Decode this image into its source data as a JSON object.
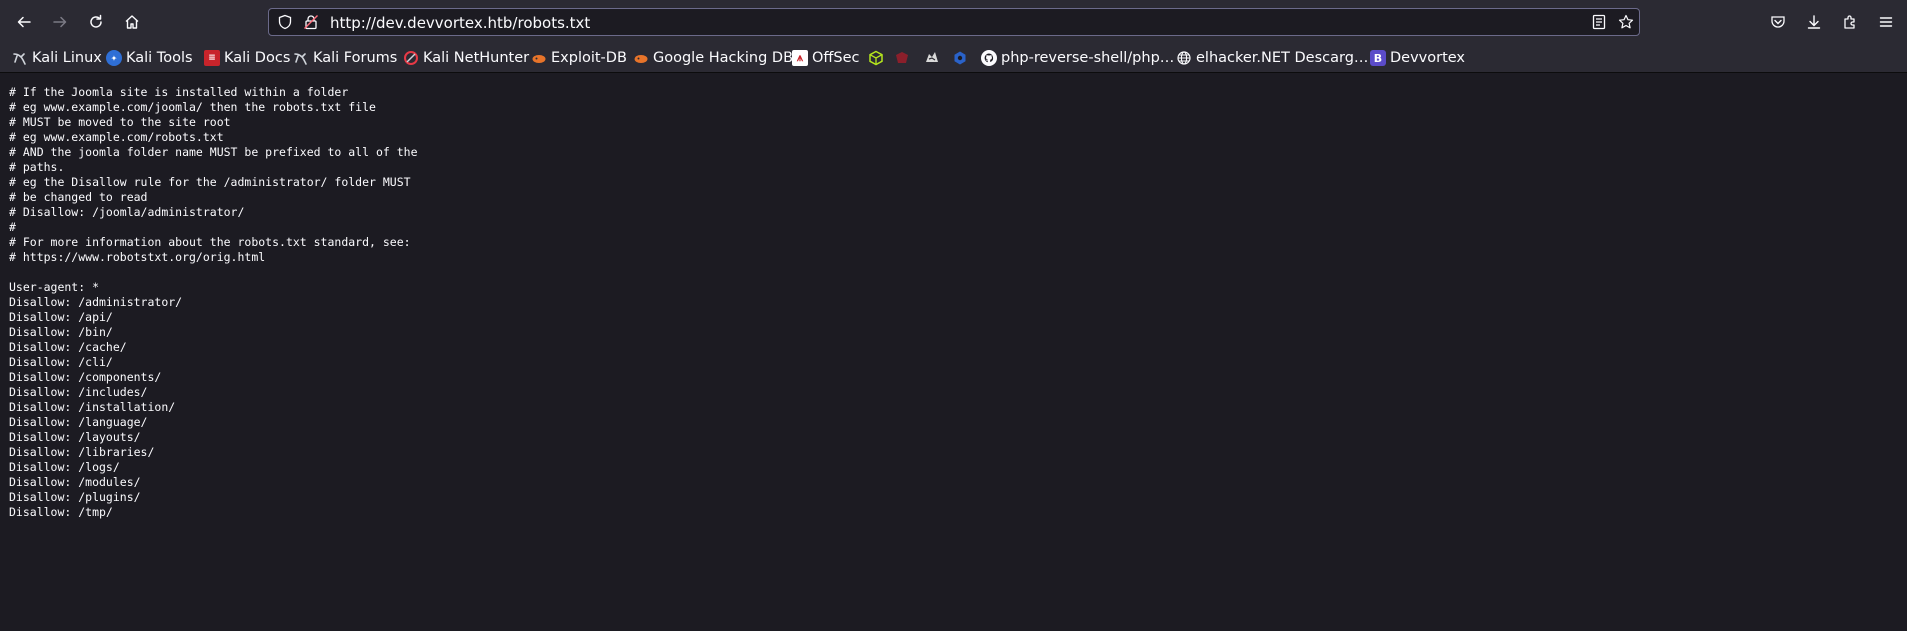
{
  "browser": {
    "url": "http://dev.devvortex.htb/robots.txt",
    "nav_icons": [
      "back-icon",
      "forward-icon",
      "reload-icon",
      "home-icon"
    ],
    "url_icons": [
      "tracking-shield-icon",
      "insecure-lock-icon",
      "reader-view-icon",
      "bookmark-star-icon"
    ],
    "toolbar_icons": [
      "pocket-icon",
      "downloads-icon",
      "extensions-icon",
      "menu-icon"
    ]
  },
  "bookmarks": [
    {
      "label": "Kali Linux",
      "icon": "kali-dragon-icon"
    },
    {
      "label": "Kali Tools",
      "icon": "kali-tools-icon"
    },
    {
      "label": "Kali Docs",
      "icon": "kali-docs-icon"
    },
    {
      "label": "Kali Forums",
      "icon": "kali-dragon-icon"
    },
    {
      "label": "Kali NetHunter",
      "icon": "nethunter-icon"
    },
    {
      "label": "Exploit-DB",
      "icon": "exploit-db-icon"
    },
    {
      "label": "Google Hacking DB",
      "icon": "ghdb-icon"
    },
    {
      "label": "OffSec",
      "icon": "offsec-icon"
    },
    {
      "label": "",
      "icon": "cube-icon"
    },
    {
      "label": "",
      "icon": "red-shape-icon"
    },
    {
      "label": "",
      "icon": "badger-icon"
    },
    {
      "label": "",
      "icon": "blue-hex-icon"
    },
    {
      "label": "php-reverse-shell/php…",
      "icon": "github-icon"
    },
    {
      "label": "elhacker.NET Descarg…",
      "icon": "globe-icon"
    },
    {
      "label": "Devvortex",
      "icon": "devvortex-b-icon"
    }
  ],
  "page": {
    "robots_txt": "# If the Joomla site is installed within a folder\n# eg www.example.com/joomla/ then the robots.txt file\n# MUST be moved to the site root\n# eg www.example.com/robots.txt\n# AND the joomla folder name MUST be prefixed to all of the\n# paths.\n# eg the Disallow rule for the /administrator/ folder MUST\n# be changed to read\n# Disallow: /joomla/administrator/\n#\n# For more information about the robots.txt standard, see:\n# https://www.robotstxt.org/orig.html\n\nUser-agent: *\nDisallow: /administrator/\nDisallow: /api/\nDisallow: /bin/\nDisallow: /cache/\nDisallow: /cli/\nDisallow: /components/\nDisallow: /includes/\nDisallow: /installation/\nDisallow: /language/\nDisallow: /layouts/\nDisallow: /libraries/\nDisallow: /logs/\nDisallow: /modules/\nDisallow: /plugins/\nDisallow: /tmp/"
  },
  "colors": {
    "toolbar": "#2b2a33",
    "page_background": "#1c1b22",
    "text": "#fbfbfe",
    "urlbar_border": "#6b6a8a"
  }
}
